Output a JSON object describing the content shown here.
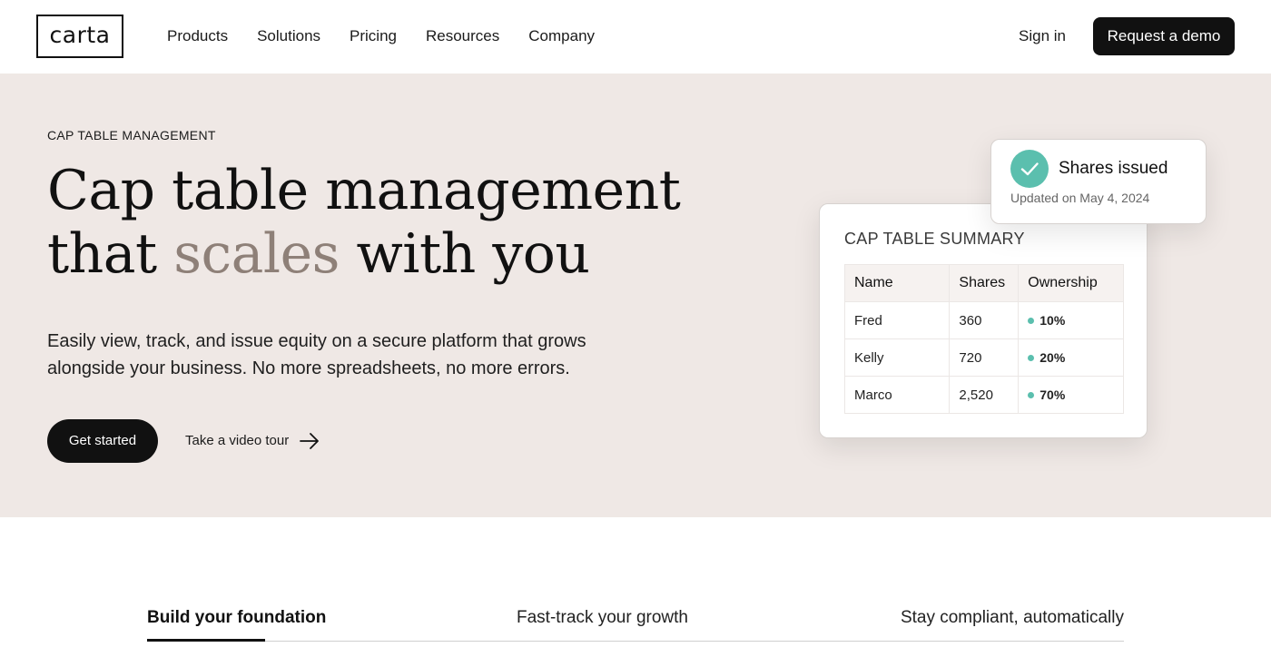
{
  "nav": {
    "logo_text": "carta",
    "menu": [
      "Products",
      "Solutions",
      "Pricing",
      "Resources",
      "Company"
    ],
    "signin_label": "Sign in",
    "demo_label": "Request a demo"
  },
  "hero": {
    "eyebrow": "CAP TABLE MANAGEMENT",
    "headline_line1": "Cap table management",
    "headline_line2_pre": "that ",
    "headline_line2_accent": "scales",
    "headline_line2_post": " with you",
    "subtext": "Easily view, track, and issue equity on a secure platform that grows alongside your business. No more spreadsheets, no more errors.",
    "primary_cta": "Get started",
    "secondary_cta": "Take a video tour",
    "accent_color": "#8e8078"
  },
  "summary_card": {
    "title": "CAP TABLE SUMMARY",
    "columns": [
      "Name",
      "Shares",
      "Ownership"
    ],
    "rows": [
      {
        "name": "Fred",
        "shares": "360",
        "ownership": "10%"
      },
      {
        "name": "Kelly",
        "shares": "720",
        "ownership": "20%"
      },
      {
        "name": "Marco",
        "shares": "2,520",
        "ownership": "70%"
      }
    ],
    "dot_color": "#5bbfae"
  },
  "toast": {
    "title": "Shares issued",
    "subtitle": "Updated on May  4, 2024",
    "icon": "check-icon"
  },
  "tabs": {
    "items": [
      "Build your foundation",
      "Fast-track your growth",
      "Stay compliant, automatically"
    ],
    "active_index": 0
  }
}
